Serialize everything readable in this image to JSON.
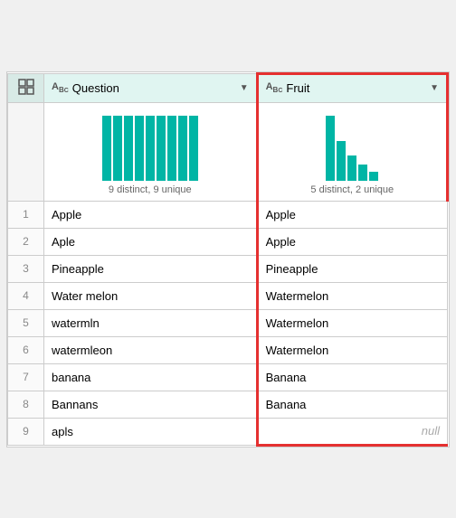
{
  "header": {
    "corner_icon": "table-icon",
    "col1": {
      "label": "Question",
      "type_icon": "abc-icon"
    },
    "col2": {
      "label": "Fruit",
      "type_icon": "abc-icon"
    }
  },
  "profile": {
    "col1": {
      "label": "9 distinct, 9 unique",
      "bars": [
        72,
        72,
        72,
        72,
        72,
        72,
        72,
        72,
        72
      ]
    },
    "col2": {
      "label": "5 distinct, 2 unique",
      "bars": [
        72,
        44,
        28,
        18,
        10
      ]
    }
  },
  "rows": [
    {
      "num": "1",
      "question": "Apple",
      "fruit": "Apple",
      "null": false
    },
    {
      "num": "2",
      "question": "Aple",
      "fruit": "Apple",
      "null": false
    },
    {
      "num": "3",
      "question": "Pineapple",
      "fruit": "Pineapple",
      "null": false
    },
    {
      "num": "4",
      "question": "Water melon",
      "fruit": "Watermelon",
      "null": false
    },
    {
      "num": "5",
      "question": "watermln",
      "fruit": "Watermelon",
      "null": false
    },
    {
      "num": "6",
      "question": "watermleon",
      "fruit": "Watermelon",
      "null": false
    },
    {
      "num": "7",
      "question": "banana",
      "fruit": "Banana",
      "null": false
    },
    {
      "num": "8",
      "question": "Bannans",
      "fruit": "Banana",
      "null": false
    },
    {
      "num": "9",
      "question": "apls",
      "fruit": "null",
      "null": true
    }
  ]
}
